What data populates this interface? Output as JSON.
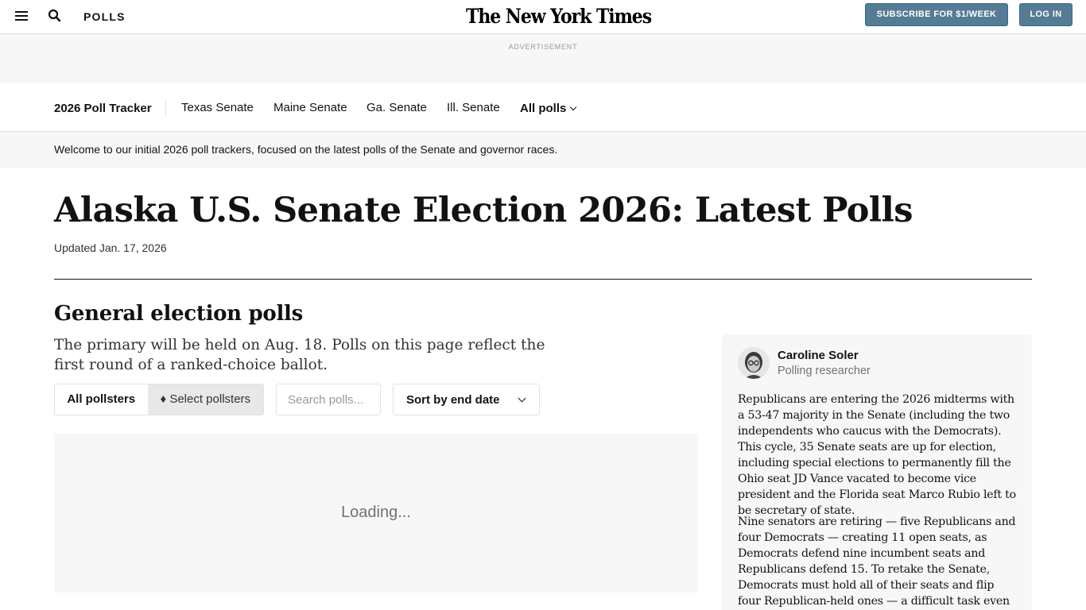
{
  "topbar": {
    "section_label": "POLLS",
    "logo_text": "The New York Times",
    "subscribe_label": "SUBSCRIBE FOR $1/WEEK",
    "login_label": "LOG IN",
    "button_color": "#567b95"
  },
  "ad": {
    "label": "ADVERTISEMENT"
  },
  "subnav": {
    "tracker_label": "2026 Poll Tracker",
    "items": [
      "Texas Senate",
      "Maine Senate",
      "Ga. Senate",
      "Ill. Senate"
    ],
    "all_polls_label": "All polls"
  },
  "welcome": {
    "text": "Welcome to our initial 2026 poll trackers, focused on the latest polls of the Senate and governor races."
  },
  "article": {
    "headline": "Alaska U.S. Senate Election 2026: Latest Polls",
    "updated": "Updated Jan. 17, 2026"
  },
  "section": {
    "title": "General election polls",
    "description": "The primary will be held on Aug. 18. Polls on this page reflect the first round of a ranked-choice ballot."
  },
  "controls": {
    "all_pollsters_label": "All pollsters",
    "select_pollsters_label": "♦ Select pollsters",
    "search_placeholder": "Search polls...",
    "sort_label": "Sort by end date"
  },
  "results": {
    "loading_text": "Loading..."
  },
  "sidebar": {
    "author_name": "Caroline Soler",
    "author_role": "Polling researcher",
    "paragraph_1": "Republicans are entering the 2026 midterms with a 53-47 majority in the Senate (including the two independents who caucus with the Democrats). This cycle, 35 Senate seats are up for election, including special elections to permanently fill the Ohio seat JD Vance vacated to become vice president and the Florida seat Marco Rubio left to be secretary of state.",
    "paragraph_2": "Nine senators are retiring — five Republicans and four Democrats — creating 11 open seats, as Democrats defend nine incumbent seats and Republicans defend 15. To retake the Senate, Democrats must hold all of their seats and flip four Republican-held ones — a difficult task even given"
  }
}
